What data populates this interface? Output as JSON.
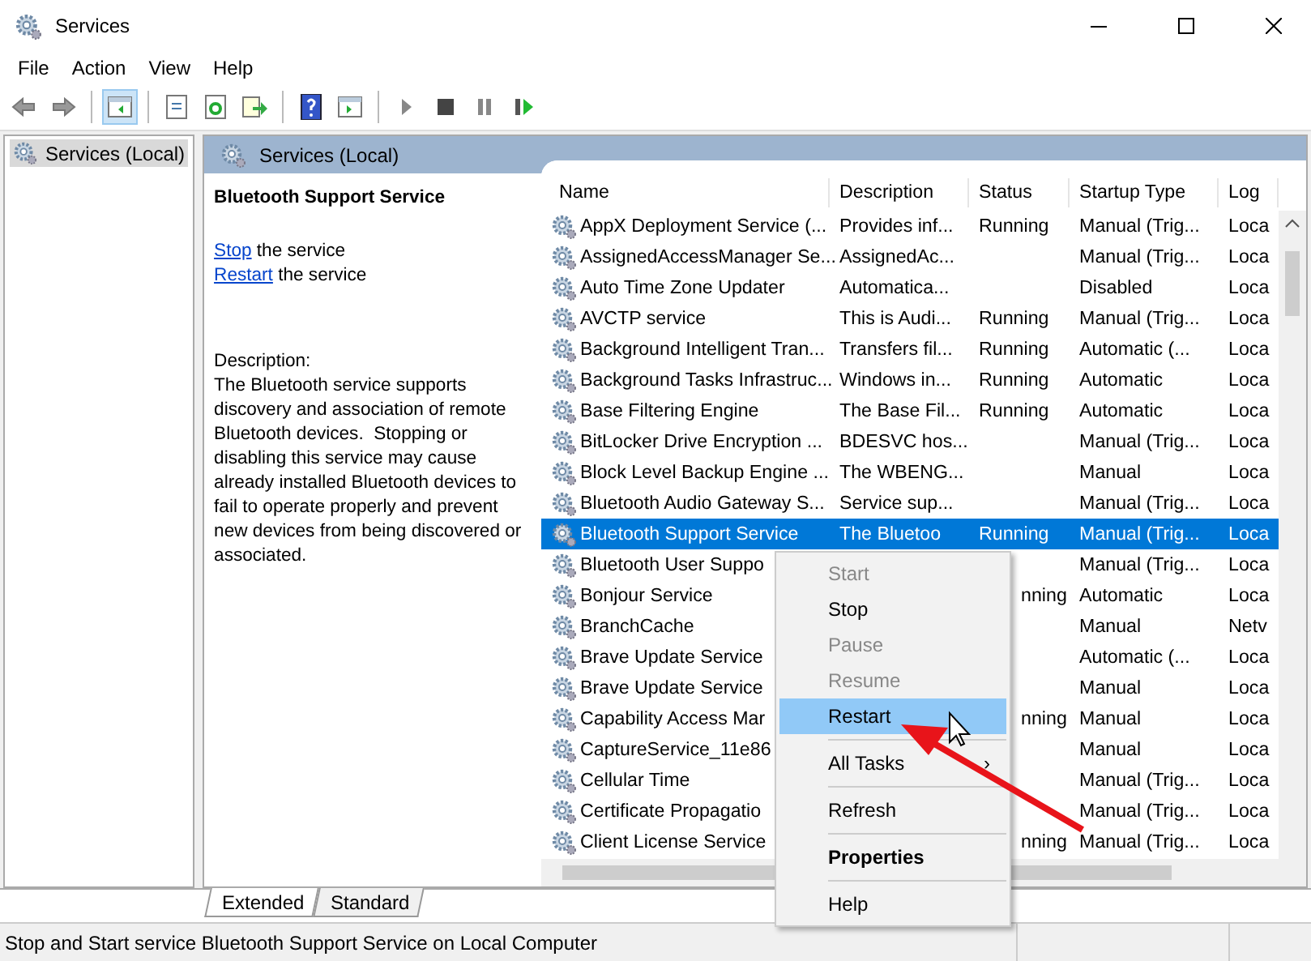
{
  "window": {
    "title": "Services"
  },
  "menu_bar": [
    "File",
    "Action",
    "View",
    "Help"
  ],
  "toolbar": [
    {
      "kind": "back",
      "selected": false
    },
    {
      "kind": "forward",
      "selected": false
    },
    {
      "kind": "sep"
    },
    {
      "kind": "tree",
      "selected": true
    },
    {
      "kind": "sep"
    },
    {
      "kind": "properties",
      "selected": false
    },
    {
      "kind": "refresh",
      "selected": false
    },
    {
      "kind": "export",
      "selected": false
    },
    {
      "kind": "sep"
    },
    {
      "kind": "help",
      "selected": false
    },
    {
      "kind": "view",
      "selected": false
    },
    {
      "kind": "sep"
    },
    {
      "kind": "play",
      "selected": false
    },
    {
      "kind": "stop",
      "selected": false
    },
    {
      "kind": "pause",
      "selected": false
    },
    {
      "kind": "resume",
      "selected": false
    }
  ],
  "tree": {
    "items": [
      {
        "label": "Services (Local)",
        "selected": true
      }
    ]
  },
  "panel": {
    "title": "Services (Local)",
    "detail": {
      "service_name": "Bluetooth Support Service",
      "actions": [
        {
          "link": "Stop",
          "text": "the service"
        },
        {
          "link": "Restart",
          "text": "the service"
        }
      ],
      "description_label": "Description:",
      "description": "The Bluetooth service supports discovery and association of remote Bluetooth devices.  Stopping or disabling this service may cause already installed Bluetooth devices to fail to operate properly and prevent new devices from being discovered or associated."
    },
    "table": {
      "columns": [
        "Name",
        "Description",
        "Status",
        "Startup Type",
        "Log"
      ],
      "rows": [
        {
          "name": "AppX Deployment Service (...",
          "description": "Provides inf...",
          "status": "Running",
          "startup": "Manual (Trig...",
          "log": "Loca",
          "selected": false
        },
        {
          "name": "AssignedAccessManager Se...",
          "description": "AssignedAc...",
          "status": "",
          "startup": "Manual (Trig...",
          "log": "Loca",
          "selected": false
        },
        {
          "name": "Auto Time Zone Updater",
          "description": "Automatica...",
          "status": "",
          "startup": "Disabled",
          "log": "Loca",
          "selected": false
        },
        {
          "name": "AVCTP service",
          "description": "This is Audi...",
          "status": "Running",
          "startup": "Manual (Trig...",
          "log": "Loca",
          "selected": false
        },
        {
          "name": "Background Intelligent Tran...",
          "description": "Transfers fil...",
          "status": "Running",
          "startup": "Automatic (...",
          "log": "Loca",
          "selected": false
        },
        {
          "name": "Background Tasks Infrastruc...",
          "description": "Windows in...",
          "status": "Running",
          "startup": "Automatic",
          "log": "Loca",
          "selected": false
        },
        {
          "name": "Base Filtering Engine",
          "description": "The Base Fil...",
          "status": "Running",
          "startup": "Automatic",
          "log": "Loca",
          "selected": false
        },
        {
          "name": "BitLocker Drive Encryption ...",
          "description": "BDESVC hos...",
          "status": "",
          "startup": "Manual (Trig...",
          "log": "Loca",
          "selected": false
        },
        {
          "name": "Block Level Backup Engine ...",
          "description": "The WBENG...",
          "status": "",
          "startup": "Manual",
          "log": "Loca",
          "selected": false
        },
        {
          "name": "Bluetooth Audio Gateway S...",
          "description": "Service sup...",
          "status": "",
          "startup": "Manual (Trig...",
          "log": "Loca",
          "selected": false
        },
        {
          "name": "Bluetooth Support Service",
          "description": "The Bluetoo",
          "status": "Running",
          "startup": "Manual (Trig...",
          "log": "Loca",
          "selected": true
        },
        {
          "name": "Bluetooth User Suppo",
          "description": "",
          "status": "",
          "startup": "Manual (Trig...",
          "log": "Loca",
          "selected": false
        },
        {
          "name": "Bonjour Service",
          "description": "",
          "status": "nning",
          "startup": "Automatic",
          "log": "Loca",
          "selected": false
        },
        {
          "name": "BranchCache",
          "description": "",
          "status": "",
          "startup": "Manual",
          "log": "Netv",
          "selected": false
        },
        {
          "name": "Brave Update Service",
          "description": "",
          "status": "",
          "startup": "Automatic (...",
          "log": "Loca",
          "selected": false
        },
        {
          "name": "Brave Update Service",
          "description": "",
          "status": "",
          "startup": "Manual",
          "log": "Loca",
          "selected": false
        },
        {
          "name": "Capability Access Mar",
          "description": "",
          "status": "nning",
          "startup": "Manual",
          "log": "Loca",
          "selected": false
        },
        {
          "name": "CaptureService_11e86",
          "description": "",
          "status": "",
          "startup": "Manual",
          "log": "Loca",
          "selected": false
        },
        {
          "name": "Cellular Time",
          "description": "",
          "status": "",
          "startup": "Manual (Trig...",
          "log": "Loca",
          "selected": false
        },
        {
          "name": "Certificate Propagatio",
          "description": "",
          "status": "",
          "startup": "Manual (Trig...",
          "log": "Loca",
          "selected": false
        },
        {
          "name": "Client License Service",
          "description": "",
          "status": "nning",
          "startup": "Manual (Trig...",
          "log": "Loca",
          "selected": false
        }
      ]
    }
  },
  "context_menu": [
    {
      "kind": "item",
      "label": "Start",
      "disabled": true,
      "selected": false
    },
    {
      "kind": "item",
      "label": "Stop",
      "disabled": false,
      "selected": false
    },
    {
      "kind": "item",
      "label": "Pause",
      "disabled": true,
      "selected": false
    },
    {
      "kind": "item",
      "label": "Resume",
      "disabled": true,
      "selected": false
    },
    {
      "kind": "item",
      "label": "Restart",
      "disabled": false,
      "selected": true
    },
    {
      "kind": "separator"
    },
    {
      "kind": "submenu",
      "label": "All Tasks",
      "arrow": "›",
      "disabled": false,
      "selected": false
    },
    {
      "kind": "separator"
    },
    {
      "kind": "item",
      "label": "Refresh",
      "disabled": false,
      "selected": false
    },
    {
      "kind": "separator"
    },
    {
      "kind": "default",
      "label": "Properties",
      "disabled": false,
      "selected": false
    },
    {
      "kind": "separator"
    },
    {
      "kind": "item",
      "label": "Help",
      "disabled": false,
      "selected": false
    }
  ],
  "tabs": [
    {
      "label": "Extended",
      "selected": true
    },
    {
      "label": "Standard",
      "selected": false
    }
  ],
  "status_bar": "Stop and Start service Bluetooth Support Service on Local Computer"
}
